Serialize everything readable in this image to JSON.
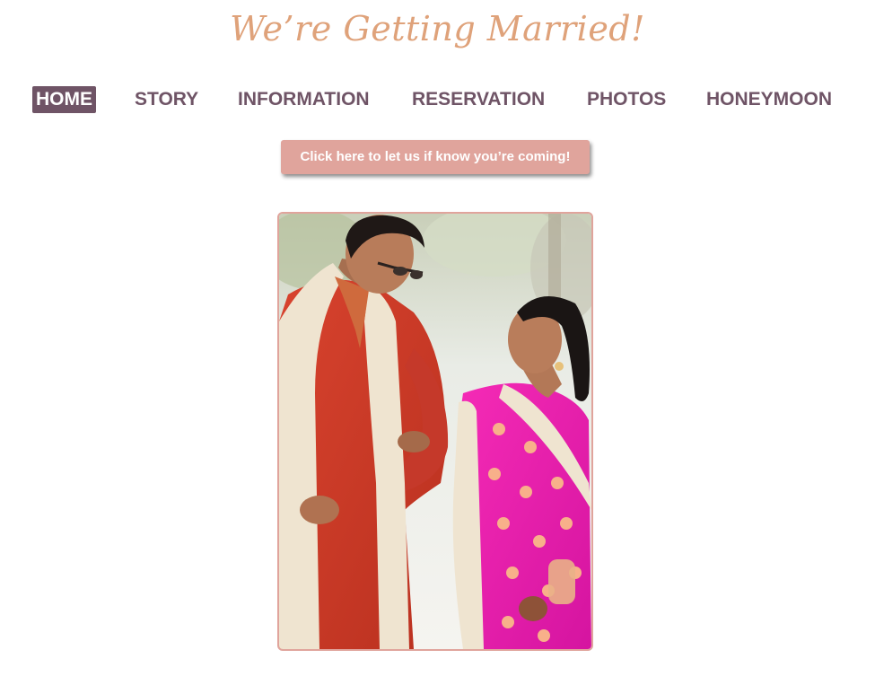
{
  "header": {
    "title": "We’re Getting Married!"
  },
  "nav": {
    "items": [
      {
        "label": "HOME",
        "active": true
      },
      {
        "label": "STORY",
        "active": false
      },
      {
        "label": "INFORMATION",
        "active": false
      },
      {
        "label": "RESERVATION",
        "active": false
      },
      {
        "label": "PHOTOS",
        "active": false
      },
      {
        "label": "HONEYMOON",
        "active": false
      }
    ]
  },
  "rsvp": {
    "label": "Click here to let us if know you’re coming!"
  },
  "photo": {
    "subject": "couple-photo"
  },
  "colors": {
    "title": "#dfa27a",
    "nav": "#6f5466",
    "accent": "#e0a49c"
  }
}
